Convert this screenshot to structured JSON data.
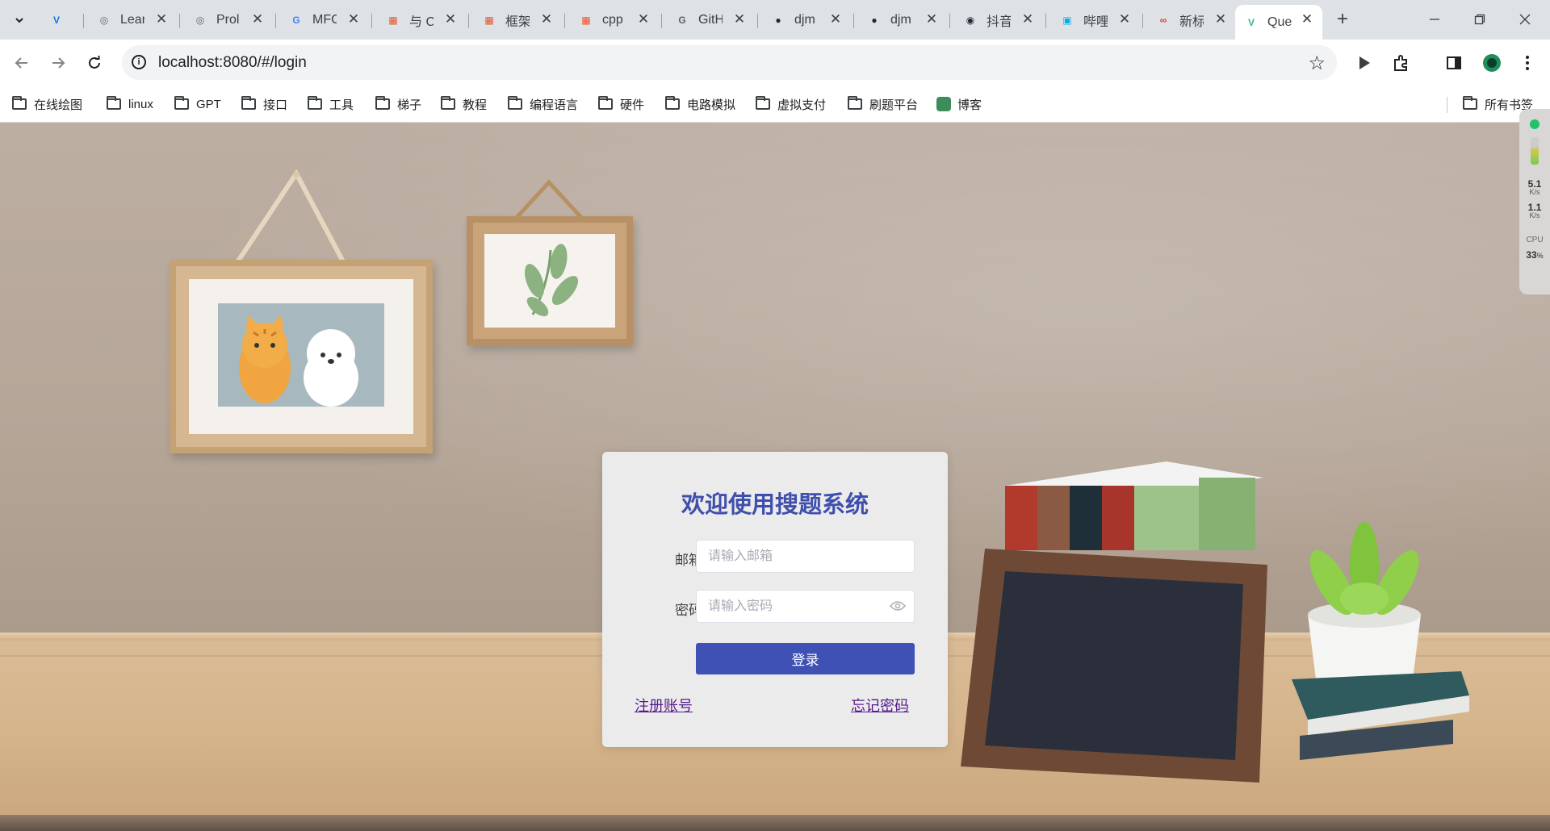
{
  "browser": {
    "tabs": [
      {
        "title": "",
        "favicon": "v-logo-icon",
        "color": "#1a73e8"
      },
      {
        "title": "Lear",
        "favicon": "leetcode-icon",
        "color": "#5f6368"
      },
      {
        "title": "Prol",
        "favicon": "globe-icon",
        "color": "#5f6368"
      },
      {
        "title": "MFC",
        "favicon": "google-g-icon",
        "color": "#4285f4"
      },
      {
        "title": "与 C",
        "favicon": "microsoft-icon",
        "color": "#f25022"
      },
      {
        "title": "框架",
        "favicon": "microsoft-icon",
        "color": "#f25022"
      },
      {
        "title": "cpp",
        "favicon": "microsoft-icon",
        "color": "#f25022"
      },
      {
        "title": "GitH",
        "favicon": "google-g-icon",
        "color": "#5f6368"
      },
      {
        "title": "djm",
        "favicon": "github-icon",
        "color": "#24292f"
      },
      {
        "title": "djm",
        "favicon": "github-icon",
        "color": "#24292f"
      },
      {
        "title": "抖音",
        "favicon": "tiktok-icon",
        "color": "#24292f"
      },
      {
        "title": "哔哩",
        "favicon": "bilibili-icon",
        "color": "#00aeec"
      },
      {
        "title": "新标",
        "favicon": "infinity-icon",
        "color": "#e53935"
      },
      {
        "title": "Que",
        "favicon": "vue-icon",
        "color": "#42b883",
        "active": true
      }
    ],
    "address": "localhost:8080/#/login",
    "bookmarks": [
      "在线绘图",
      "linux",
      "GPT",
      "接口",
      "工具",
      "梯子",
      "教程",
      "编程语言",
      "硬件",
      "电路模拟",
      "虚拟支付",
      "刷题平台",
      "博客"
    ],
    "all_bookmarks": "所有书签"
  },
  "speed_widget": {
    "up_value": "5.1",
    "up_unit": "K/s",
    "down_value": "1.1",
    "down_unit": "K/s",
    "cpu_label": "CPU",
    "cpu_value": "33",
    "cpu_unit": "%"
  },
  "login": {
    "title": "欢迎使用搜题系统",
    "email_label": "邮箱",
    "email_placeholder": "请输入邮箱",
    "email_value": "",
    "password_label": "密码",
    "password_placeholder": "请输入密码",
    "password_value": "",
    "submit_label": "登录",
    "register_link": "注册账号",
    "forgot_link": "忘记密码",
    "accent_color": "#3f51b5"
  }
}
